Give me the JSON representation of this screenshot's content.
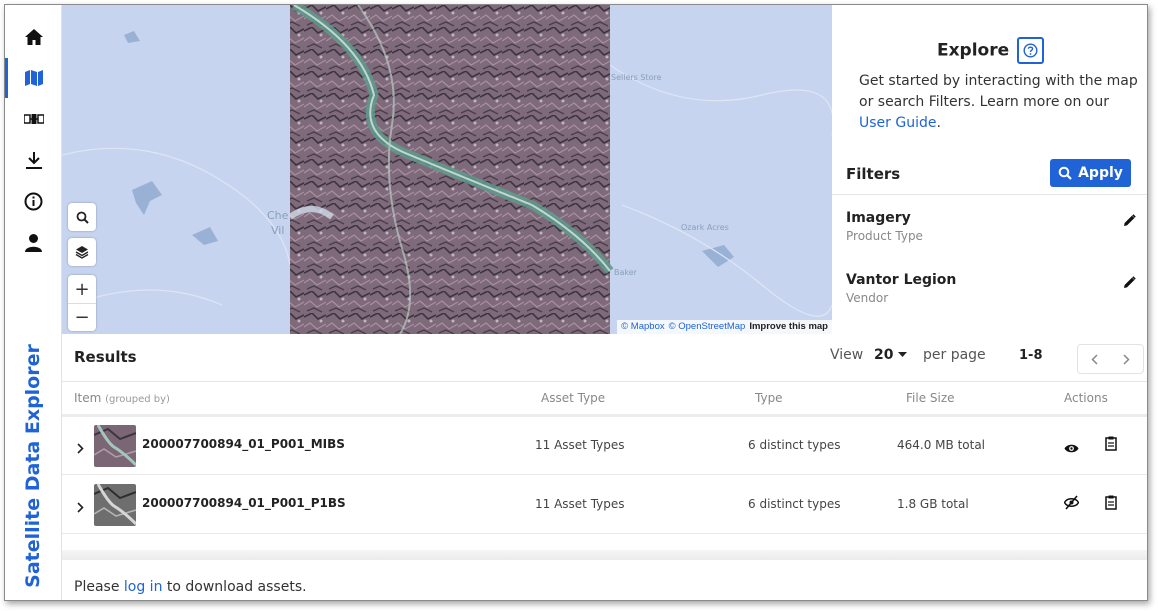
{
  "app": {
    "title": "Satellite Data Explorer",
    "accent": "#1f63d6"
  },
  "rail": {
    "items": [
      {
        "icon": "home-icon",
        "label": "Home"
      },
      {
        "icon": "map-icon",
        "label": "Map",
        "active": true
      },
      {
        "icon": "satellite-icon",
        "label": "Satellite"
      },
      {
        "icon": "download-icon",
        "label": "Download"
      },
      {
        "icon": "info-icon",
        "label": "Info"
      },
      {
        "icon": "user-icon",
        "label": "Account"
      }
    ]
  },
  "map": {
    "labels": [
      "Sellers Store",
      "Ozark Acres",
      "Baker",
      "Che",
      "Vil"
    ],
    "attribution": {
      "mapbox": "© Mapbox",
      "osm": "© OpenStreetMap",
      "improve": "Improve this map"
    }
  },
  "explore": {
    "title": "Explore",
    "desc_prefix": "Get started by interacting with the map or search Filters. Learn more on our ",
    "desc_link": "User Guide",
    "desc_suffix": "."
  },
  "filters": {
    "title": "Filters",
    "apply_label": "Apply",
    "items": [
      {
        "name": "Imagery",
        "sub": "Product Type"
      },
      {
        "name": "Vantor Legion",
        "sub": "Vendor"
      }
    ]
  },
  "results": {
    "title": "Results",
    "view_label": "View",
    "per_page_value": "20",
    "per_page_label": "per page",
    "range": "1-8",
    "columns": {
      "item": "Item",
      "item_note": "(grouped by)",
      "asset_type": "Asset Type",
      "type": "Type",
      "file_size": "File Size",
      "actions": "Actions"
    },
    "rows": [
      {
        "name": "200007700894_01_P001_MIBS",
        "asset_types": "11 Asset Types",
        "type": "6 distinct types",
        "size": "464.0 MB total",
        "visible": true
      },
      {
        "name": "200007700894_01_P001_P1BS",
        "asset_types": "11 Asset Types",
        "type": "6 distinct types",
        "size": "1.8 GB total",
        "visible": false
      }
    ]
  },
  "footer": {
    "prefix": "Please ",
    "link": "log in",
    "suffix": " to download assets."
  }
}
